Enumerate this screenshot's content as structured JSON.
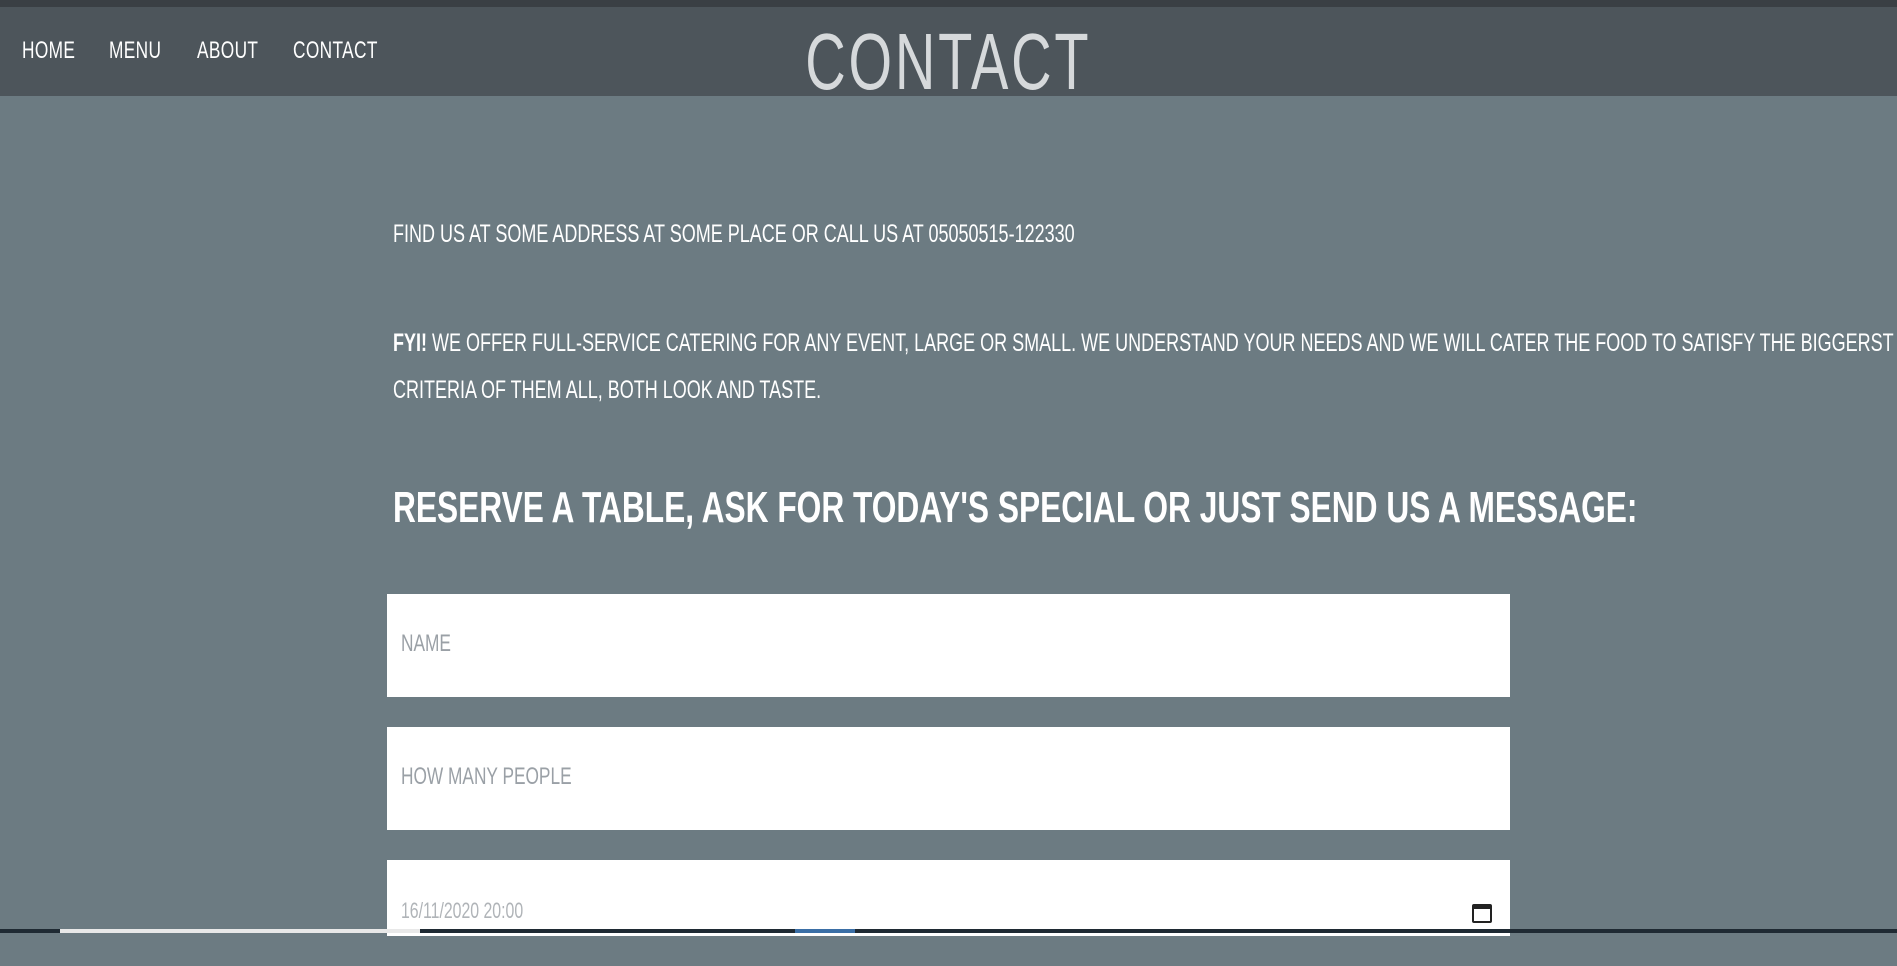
{
  "nav": {
    "links": [
      "HOME",
      "MENU",
      "ABOUT",
      "CONTACT"
    ]
  },
  "page_title": "CONTACT",
  "info": {
    "find_us": "FIND US AT SOME ADDRESS AT SOME PLACE OR CALL US AT 05050515-122330",
    "fyi_label": "FYI!",
    "fyi_line1": " WE OFFER FULL-SERVICE CATERING FOR ANY EVENT, LARGE OR SMALL. WE UNDERSTAND YOUR NEEDS AND WE WILL CATER THE FOOD TO SATISFY THE BIGGERST",
    "fyi_line2": "CRITERIA OF THEM ALL, BOTH LOOK AND TASTE."
  },
  "reserve": {
    "bold": "RESERVE",
    "rest": " A TABLE, ASK FOR TODAY'S SPECIAL OR JUST SEND US A MESSAGE:"
  },
  "form": {
    "name_placeholder": "NAME",
    "people_placeholder": "HOW MANY PEOPLE",
    "datetime_value": "16/11/2020 20:00"
  },
  "icons": {
    "calendar": "calendar-icon"
  },
  "colors": {
    "background": "#6c7b82",
    "navbar": "#4d555b",
    "title": "#d6d9db"
  }
}
